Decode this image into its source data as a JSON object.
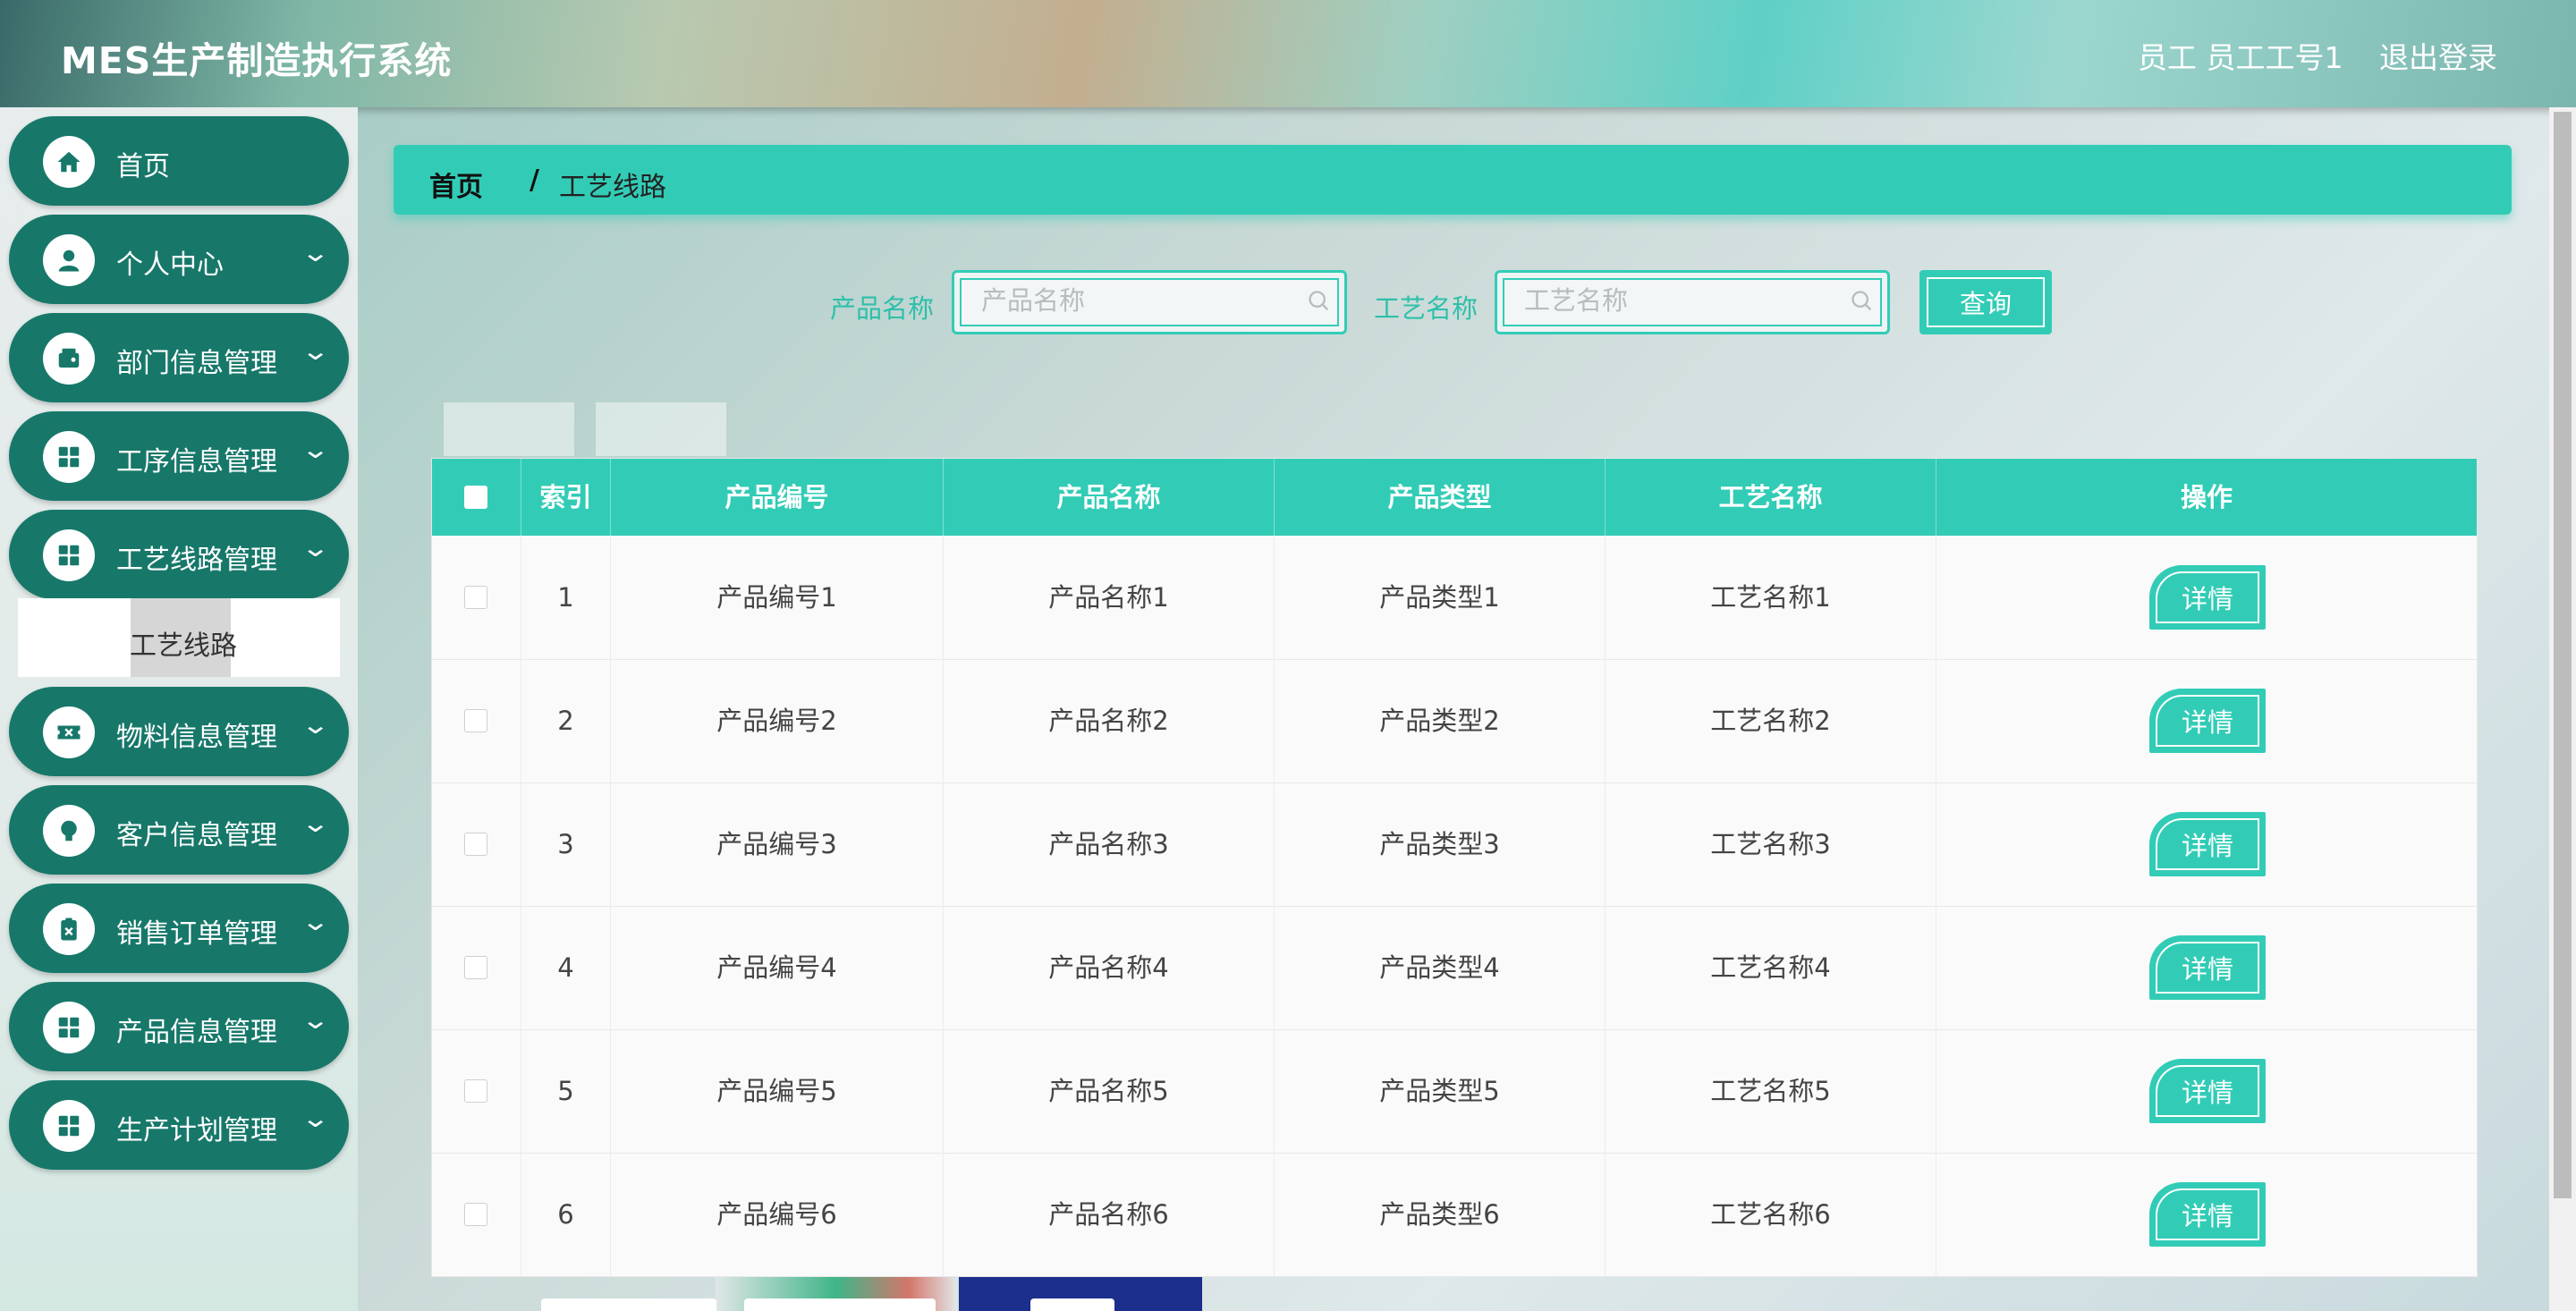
{
  "header": {
    "title": "MES生产制造执行系统",
    "user": "员工 员工工号1",
    "logout": "退出登录"
  },
  "sidebar": {
    "items": [
      {
        "label": "首页",
        "icon": "home-icon"
      },
      {
        "label": "个人中心",
        "icon": "user-icon"
      },
      {
        "label": "部门信息管理",
        "icon": "wallet-icon"
      },
      {
        "label": "工序信息管理",
        "icon": "grid-icon"
      },
      {
        "label": "工艺线路管理",
        "icon": "grid-icon"
      },
      {
        "label": "物料信息管理",
        "icon": "ticket-icon"
      },
      {
        "label": "客户信息管理",
        "icon": "bulb-icon"
      },
      {
        "label": "销售订单管理",
        "icon": "clipboard-icon"
      },
      {
        "label": "产品信息管理",
        "icon": "grid-icon"
      },
      {
        "label": "生产计划管理",
        "icon": "grid-icon"
      }
    ],
    "active_sub": "工艺线路"
  },
  "breadcrumb": {
    "home": "首页",
    "sep": "/",
    "current": "工艺线路"
  },
  "search": {
    "product_label": "产品名称",
    "product_placeholder": "产品名称",
    "process_label": "工艺名称",
    "process_placeholder": "工艺名称",
    "query": "查询"
  },
  "table": {
    "headers": [
      "索引",
      "产品编号",
      "产品名称",
      "产品类型",
      "工艺名称",
      "操作"
    ],
    "rows": [
      {
        "index": "1",
        "code": "产品编号1",
        "name": "产品名称1",
        "type": "产品类型1",
        "process": "工艺名称1",
        "action": "详情"
      },
      {
        "index": "2",
        "code": "产品编号2",
        "name": "产品名称2",
        "type": "产品类型2",
        "process": "工艺名称2",
        "action": "详情"
      },
      {
        "index": "3",
        "code": "产品编号3",
        "name": "产品名称3",
        "type": "产品类型3",
        "process": "工艺名称3",
        "action": "详情"
      },
      {
        "index": "4",
        "code": "产品编号4",
        "name": "产品名称4",
        "type": "产品类型4",
        "process": "工艺名称4",
        "action": "详情"
      },
      {
        "index": "5",
        "code": "产品编号5",
        "name": "产品名称5",
        "type": "产品类型5",
        "process": "工艺名称5",
        "action": "详情"
      },
      {
        "index": "6",
        "code": "产品编号6",
        "name": "产品名称6",
        "type": "产品类型6",
        "process": "工艺名称6",
        "action": "详情"
      }
    ]
  },
  "colors": {
    "accent": "#32ccb6",
    "sidebar_item": "#17786a"
  }
}
